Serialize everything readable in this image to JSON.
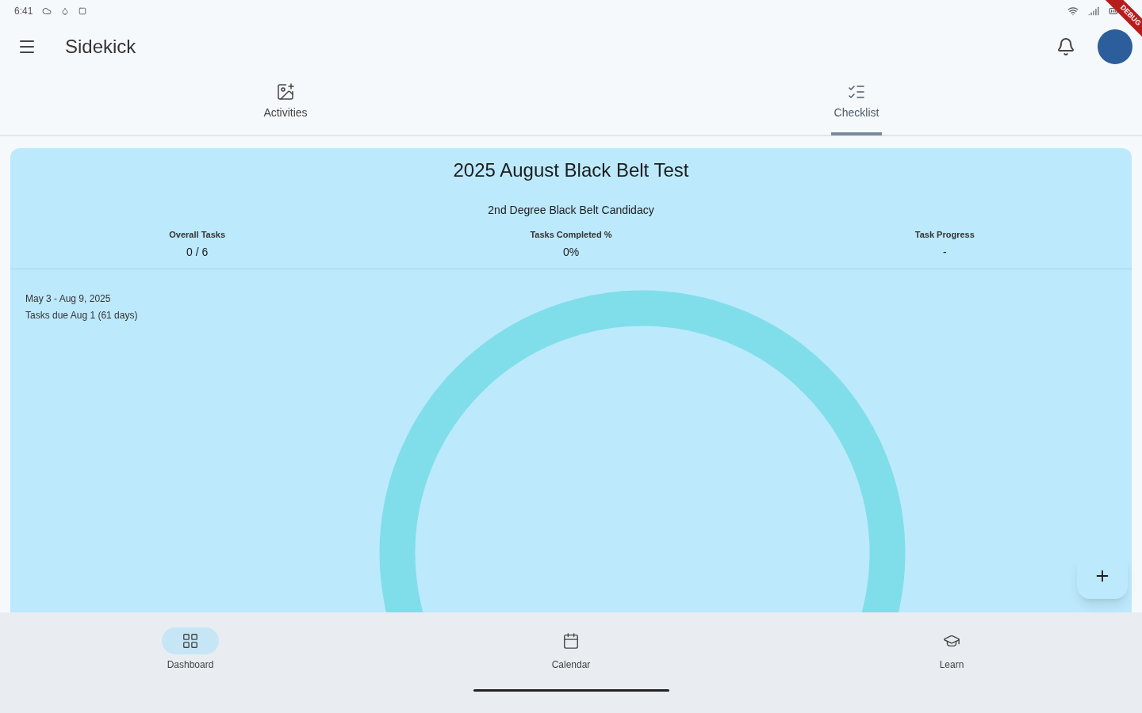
{
  "status_bar": {
    "time": "6:41"
  },
  "app_bar": {
    "title": "Sidekick"
  },
  "tabs": [
    {
      "label": "Activities",
      "selected": false
    },
    {
      "label": "Checklist",
      "selected": true
    }
  ],
  "card": {
    "title": "2025 August Black Belt Test",
    "subtitle": "2nd Degree Black Belt Candidacy",
    "stats": [
      {
        "label": "Overall Tasks",
        "value": "0 / 6"
      },
      {
        "label": "Tasks Completed %",
        "value": "0%"
      },
      {
        "label": "Task Progress",
        "value": "-"
      }
    ],
    "date_range": "May 3 - Aug 9, 2025",
    "due": "Tasks due Aug 1 (61 days)"
  },
  "nav": [
    {
      "label": "Dashboard",
      "selected": true
    },
    {
      "label": "Calendar",
      "selected": false
    },
    {
      "label": "Learn",
      "selected": false
    }
  ],
  "debug_banner": "DEBUG"
}
